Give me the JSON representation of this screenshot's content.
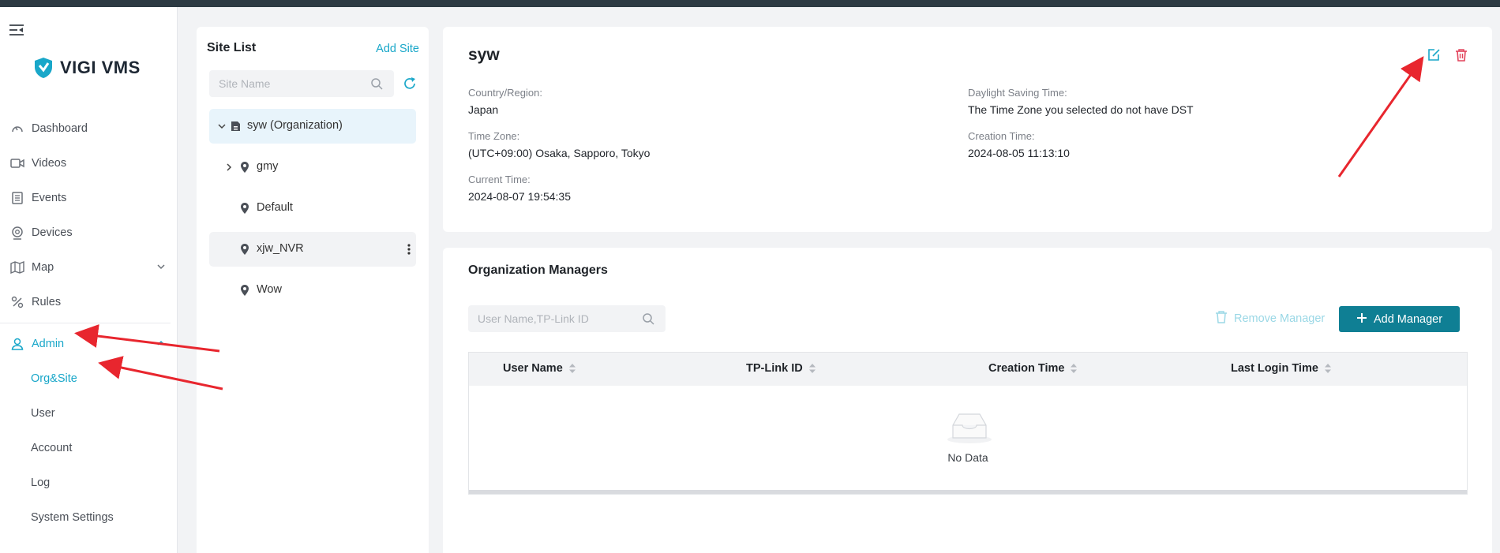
{
  "app": {
    "name": "VIGI VMS",
    "accent": "#19a7c9",
    "primary_button": "#0f7f94",
    "annotation_color": "#e8262e"
  },
  "sidebar": {
    "items": [
      {
        "label": "Dashboard",
        "icon": "dashboard-icon"
      },
      {
        "label": "Videos",
        "icon": "video-icon"
      },
      {
        "label": "Events",
        "icon": "events-icon"
      },
      {
        "label": "Devices",
        "icon": "camera-icon"
      },
      {
        "label": "Map",
        "icon": "map-icon"
      },
      {
        "label": "Rules",
        "icon": "rules-icon"
      },
      {
        "label": "Admin",
        "icon": "user-icon"
      }
    ],
    "admin_subitems": [
      {
        "label": "Org&Site"
      },
      {
        "label": "User"
      },
      {
        "label": "Account"
      },
      {
        "label": "Log"
      },
      {
        "label": "System Settings"
      }
    ]
  },
  "site_list": {
    "title": "Site List",
    "add_label": "Add Site",
    "search_placeholder": "Site Name",
    "tree": [
      {
        "label": "syw (Organization)",
        "type": "organization",
        "expanded": true
      },
      {
        "label": "gmy",
        "type": "site",
        "collapsed": true
      },
      {
        "label": "Default",
        "type": "site"
      },
      {
        "label": "xjw_NVR",
        "type": "site"
      },
      {
        "label": "Wow",
        "type": "site"
      }
    ]
  },
  "detail": {
    "name": "syw",
    "country_label": "Country/Region:",
    "country": "Japan",
    "timezone_label": "Time Zone:",
    "timezone": "(UTC+09:00) Osaka, Sapporo, Tokyo",
    "current_time_label": "Current Time:",
    "current_time": "2024-08-07 19:54:35",
    "dst_label": "Daylight Saving Time:",
    "dst": "The Time Zone you selected do not have DST",
    "creation_label": "Creation Time:",
    "creation": "2024-08-05 11:13:10"
  },
  "managers": {
    "title": "Organization Managers",
    "search_placeholder": "User Name,TP-Link ID",
    "remove_label": "Remove Manager",
    "add_label": "Add Manager",
    "columns": [
      "User Name",
      "TP-Link ID",
      "Creation Time",
      "Last Login Time"
    ],
    "empty_text": "No Data"
  }
}
